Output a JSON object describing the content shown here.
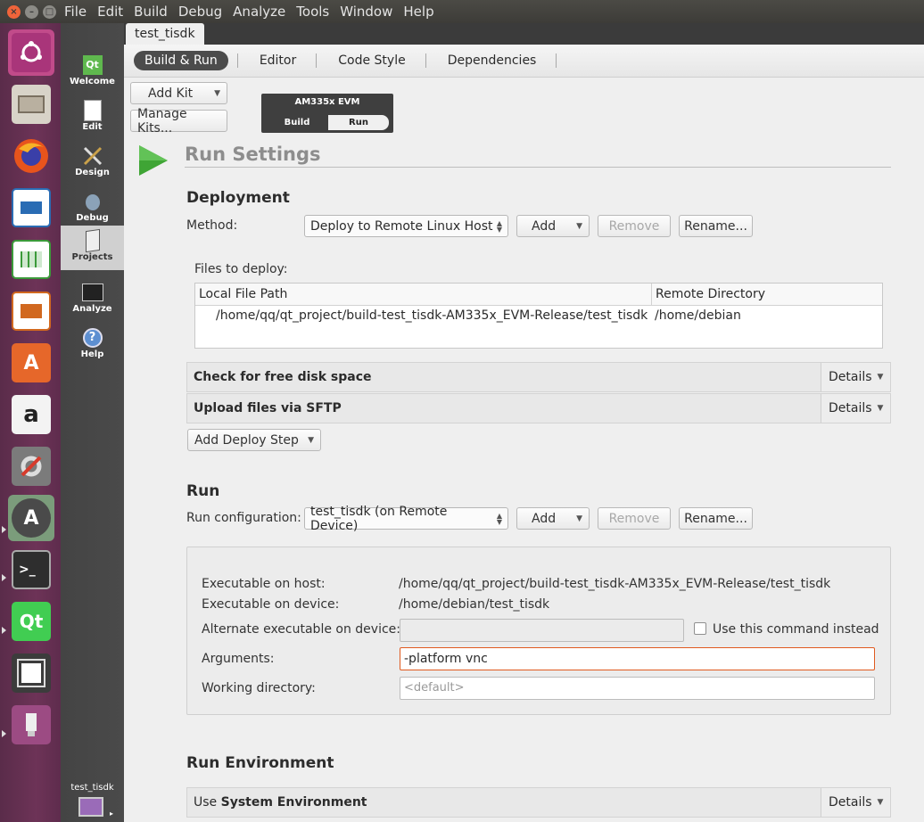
{
  "menubar": {
    "items": [
      "File",
      "Edit",
      "Build",
      "Debug",
      "Analyze",
      "Tools",
      "Window",
      "Help"
    ]
  },
  "launcher": {
    "icons": [
      "ubuntu-icon",
      "files-icon",
      "firefox-icon",
      "writer-icon",
      "calc-icon",
      "impress-icon",
      "software-center-icon",
      "amazon-icon",
      "system-settings-icon",
      "software-updater-icon",
      "terminal-icon",
      "qt-creator-icon",
      "floppy-icon",
      "usb-drive-icon"
    ]
  },
  "modes": {
    "welcome": "Welcome",
    "edit": "Edit",
    "design": "Design",
    "debug": "Debug",
    "projects": "Projects",
    "analyze": "Analyze",
    "help": "Help",
    "project_name": "test_tisdk"
  },
  "document_tab": "test_tisdk",
  "nav": {
    "build_run": "Build & Run",
    "editor": "Editor",
    "code_style": "Code Style",
    "dependencies": "Dependencies"
  },
  "kit": {
    "add_kit": "Add Kit",
    "manage_kits": "Manage Kits...",
    "name": "AM335x EVM",
    "build": "Build",
    "run": "Run"
  },
  "run_settings": {
    "title": "Run Settings"
  },
  "deployment": {
    "heading": "Deployment",
    "method_label": "Method:",
    "method_value": "Deploy to Remote Linux Host",
    "add": "Add",
    "remove": "Remove",
    "rename": "Rename...",
    "files_label": "Files to deploy:",
    "col_local": "Local File Path",
    "col_remote": "Remote Directory",
    "local_path": "/home/qq/qt_project/build-test_tisdk-AM335x_EVM-Release/test_tisdk",
    "remote_dir": "/home/debian",
    "step1": "Check for free disk space",
    "step2": "Upload files via SFTP",
    "details": "Details",
    "add_step": "Add Deploy Step"
  },
  "run": {
    "heading": "Run",
    "config_label": "Run configuration:",
    "config_value": "test_tisdk (on Remote Device)",
    "add": "Add",
    "remove": "Remove",
    "rename": "Rename...",
    "exe_host_label": "Executable on host:",
    "exe_host_value": "/home/qq/qt_project/build-test_tisdk-AM335x_EVM-Release/test_tisdk",
    "exe_device_label": "Executable on device:",
    "exe_device_value": "/home/debian/test_tisdk",
    "alt_exe_label": "Alternate executable on device:",
    "use_cmd_label": "Use this command instead",
    "args_label": "Arguments:",
    "args_value": "-platform vnc",
    "workdir_label": "Working directory:",
    "workdir_placeholder": "<default>"
  },
  "run_env": {
    "heading": "Run Environment",
    "prefix": "Use ",
    "value": "System Environment",
    "details": "Details"
  }
}
